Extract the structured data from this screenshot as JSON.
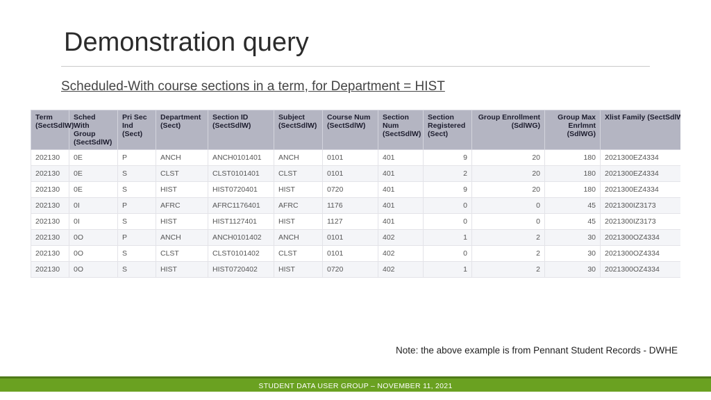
{
  "title": "Demonstration query",
  "subtitle": "Scheduled-With course sections in a term, for Department = HIST",
  "columns": [
    "Term (SectSdlW)",
    "Sched With Group (SectSdlW)",
    "Pri Sec Ind (Sect)",
    "Department (Sect)",
    "Section ID (SectSdlW)",
    "Subject (SectSdlW)",
    "Course Num (SectSdlW)",
    "Section Num (SectSdlW)",
    "Section Registered (Sect)",
    "Group Enrollment (SdlWG)",
    "Group Max Enrlmnt (SdlWG)",
    "Xlist Family (SectSdlW)"
  ],
  "rows": [
    [
      "202130",
      "0E",
      "P",
      "ANCH",
      "ANCH0101401",
      "ANCH",
      "0101",
      "401",
      "9",
      "20",
      "180",
      "2021300EZ4334"
    ],
    [
      "202130",
      "0E",
      "S",
      "CLST",
      "CLST0101401",
      "CLST",
      "0101",
      "401",
      "2",
      "20",
      "180",
      "2021300EZ4334"
    ],
    [
      "202130",
      "0E",
      "S",
      "HIST",
      "HIST0720401",
      "HIST",
      "0720",
      "401",
      "9",
      "20",
      "180",
      "2021300EZ4334"
    ],
    [
      "202130",
      "0I",
      "P",
      "AFRC",
      "AFRC1176401",
      "AFRC",
      "1176",
      "401",
      "0",
      "0",
      "45",
      "2021300IZ3173"
    ],
    [
      "202130",
      "0I",
      "S",
      "HIST",
      "HIST1127401",
      "HIST",
      "1127",
      "401",
      "0",
      "0",
      "45",
      "2021300IZ3173"
    ],
    [
      "202130",
      "0O",
      "P",
      "ANCH",
      "ANCH0101402",
      "ANCH",
      "0101",
      "402",
      "1",
      "2",
      "30",
      "2021300OZ4334"
    ],
    [
      "202130",
      "0O",
      "S",
      "CLST",
      "CLST0101402",
      "CLST",
      "0101",
      "402",
      "0",
      "2",
      "30",
      "2021300OZ4334"
    ],
    [
      "202130",
      "0O",
      "S",
      "HIST",
      "HIST0720402",
      "HIST",
      "0720",
      "402",
      "1",
      "2",
      "30",
      "2021300OZ4334"
    ]
  ],
  "note": "Note: the above example is from Pennant Student Records - DWHE",
  "footer": "STUDENT DATA USER GROUP – NOVEMBER 11, 2021"
}
